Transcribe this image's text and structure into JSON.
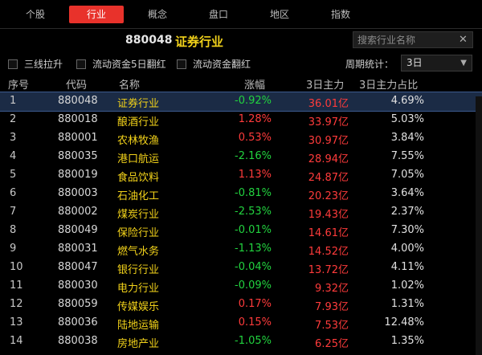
{
  "tabs": [
    {
      "label": "个股",
      "active": false
    },
    {
      "label": "行业",
      "active": true
    },
    {
      "label": "概念",
      "active": false
    },
    {
      "label": "盘口",
      "active": false
    },
    {
      "label": "地区",
      "active": false
    },
    {
      "label": "指数",
      "active": false
    }
  ],
  "title": {
    "code": "880048",
    "name": "证券行业"
  },
  "search": {
    "placeholder": "搜索行业名称",
    "clear_icon": "close-icon"
  },
  "filters": {
    "three_line": "三线拉升",
    "flow_5d": "流动资金5日翻红",
    "flow_turn": "流动资金翻红"
  },
  "period": {
    "label": "周期统计：",
    "selected": "3日"
  },
  "columns": {
    "idx": "序号",
    "code": "代码",
    "name": "名称",
    "chg": "涨幅",
    "money": "3日主力",
    "ratio": "3日主力占比"
  },
  "rows": [
    {
      "idx": "1",
      "code": "880048",
      "name": "证券行业",
      "chg": "-0.92%",
      "dir": "down",
      "money": "36.01亿",
      "ratio": "4.69%"
    },
    {
      "idx": "2",
      "code": "880018",
      "name": "酿酒行业",
      "chg": "1.28%",
      "dir": "up",
      "money": "33.97亿",
      "ratio": "5.03%"
    },
    {
      "idx": "3",
      "code": "880001",
      "name": "农林牧渔",
      "chg": "0.53%",
      "dir": "up",
      "money": "30.97亿",
      "ratio": "3.84%"
    },
    {
      "idx": "4",
      "code": "880035",
      "name": "港口航运",
      "chg": "-2.16%",
      "dir": "down",
      "money": "28.94亿",
      "ratio": "7.55%"
    },
    {
      "idx": "5",
      "code": "880019",
      "name": "食品饮料",
      "chg": "1.13%",
      "dir": "up",
      "money": "24.87亿",
      "ratio": "7.05%"
    },
    {
      "idx": "6",
      "code": "880003",
      "name": "石油化工",
      "chg": "-0.81%",
      "dir": "down",
      "money": "20.23亿",
      "ratio": "3.64%"
    },
    {
      "idx": "7",
      "code": "880002",
      "name": "煤炭行业",
      "chg": "-2.53%",
      "dir": "down",
      "money": "19.43亿",
      "ratio": "2.37%"
    },
    {
      "idx": "8",
      "code": "880049",
      "name": "保险行业",
      "chg": "-0.01%",
      "dir": "down",
      "money": "14.61亿",
      "ratio": "7.30%"
    },
    {
      "idx": "9",
      "code": "880031",
      "name": "燃气水务",
      "chg": "-1.13%",
      "dir": "down",
      "money": "14.52亿",
      "ratio": "4.00%"
    },
    {
      "idx": "10",
      "code": "880047",
      "name": "银行行业",
      "chg": "-0.04%",
      "dir": "down",
      "money": "13.72亿",
      "ratio": "4.11%"
    },
    {
      "idx": "11",
      "code": "880030",
      "name": "电力行业",
      "chg": "-0.09%",
      "dir": "down",
      "money": "9.32亿",
      "ratio": "1.02%"
    },
    {
      "idx": "12",
      "code": "880059",
      "name": "传媒娱乐",
      "chg": "0.17%",
      "dir": "up",
      "money": "7.93亿",
      "ratio": "1.31%"
    },
    {
      "idx": "13",
      "code": "880036",
      "name": "陆地运输",
      "chg": "0.15%",
      "dir": "up",
      "money": "7.53亿",
      "ratio": "12.48%"
    },
    {
      "idx": "14",
      "code": "880038",
      "name": "房地产业",
      "chg": "-1.05%",
      "dir": "down",
      "money": "6.25亿",
      "ratio": "1.35%"
    }
  ],
  "colors": {
    "up": "#ff3b3b",
    "down": "#22d33f",
    "name": "#f2d21a",
    "active_tab": "#e8322b"
  }
}
